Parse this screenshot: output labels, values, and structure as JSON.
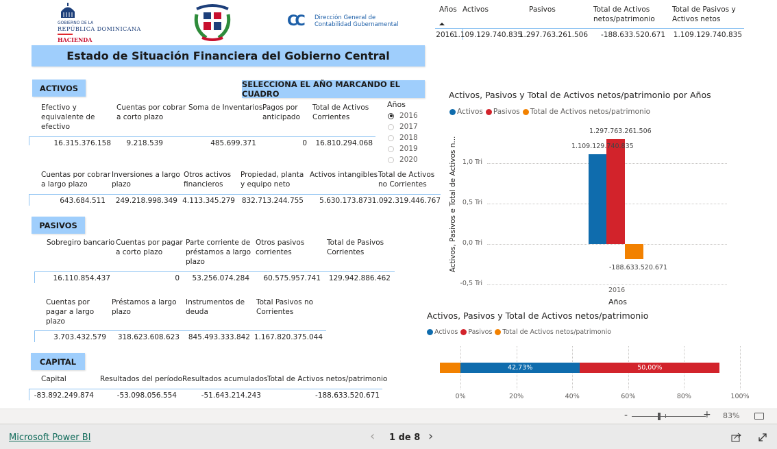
{
  "header": {
    "logo_gobierno": {
      "line1": "GOBIERNO DE LA",
      "line2": "REPÚBLICA DOMINICANA",
      "line3": "HACIENDA"
    },
    "logo_dgcg": {
      "mark": "CC",
      "line1": "Dirección General de",
      "line2": "Contabilidad Gubernamental"
    },
    "title": "Estado de Situación Financiera del Gobierno Central"
  },
  "sections": {
    "activos": "ACTIVOS",
    "pasivos": "PASIVOS",
    "capital": "CAPITAL",
    "select_year": "SELECCIONA EL AÑO MARCANDO EL CUADRO"
  },
  "year_slicer": {
    "title": "Años",
    "options": [
      {
        "label": "2016",
        "selected": true
      },
      {
        "label": "2017",
        "selected": false
      },
      {
        "label": "2018",
        "selected": false
      },
      {
        "label": "2019",
        "selected": false
      },
      {
        "label": "2020",
        "selected": false
      }
    ]
  },
  "tables": {
    "activos_corrientes": {
      "headers": [
        "Efectivo y\nequivalente de\nefectivo",
        "Cuentas por cobrar\na corto plazo",
        "Soma de Inventarios",
        "Pagos por\nanticipado",
        "Total de Activos\nCorrientes"
      ],
      "values": [
        "16.315.376.158",
        "9.218.539",
        "485.699.371",
        "0",
        "16.810.294.068"
      ]
    },
    "activos_no_corrientes": {
      "headers": [
        "Cuentas por cobrar\na largo plazo",
        "Inversiones a largo\nplazo",
        "Otros activos\nfinancieros",
        "Propiedad, planta\ny equipo neto",
        "Activos intangibles",
        "Total de Activos\nno Corrientes"
      ],
      "values": [
        "643.684.511",
        "249.218.998.349",
        "4.113.345.279",
        "832.713.244.755",
        "5.630.173.873",
        "1.092.319.446.767"
      ]
    },
    "pasivos_corrientes": {
      "headers": [
        "Sobregiro bancario",
        "Cuentas por pagar\na corto plazo",
        "Parte corriente de\npréstamos a largo\nplazo",
        "Otros pasivos\ncorrientes",
        "Total de Pasivos\nCorrientes"
      ],
      "values": [
        "16.110.854.437",
        "0",
        "53.256.074.284",
        "60.575.957.741",
        "129.942.886.462"
      ]
    },
    "pasivos_no_corrientes": {
      "headers": [
        "Cuentas por\npagar a largo\nplazo",
        "Préstamos a largo\nplazo",
        "Instrumentos de\ndeuda",
        "Total Pasivos no\nCorrientes"
      ],
      "values": [
        "3.703.432.579",
        "318.623.608.623",
        "845.493.333.842",
        "1.167.820.375.044"
      ]
    },
    "capital": {
      "headers": [
        "Capital",
        "Resultados del período",
        "Resultados acumulados",
        "Total de Activos netos/patrimonio"
      ],
      "values": [
        "-83.892.249.874",
        "-53.098.056.554",
        "-51.643.214.243",
        "-188.633.520.671"
      ]
    },
    "resumen": {
      "headers": [
        "Años",
        "Activos",
        "Pasivos",
        "Total de Activos\nnetos/patrimonio",
        "Total de Pasivos y\nActivos netos"
      ],
      "values": [
        "2016",
        "1.109.129.740.835",
        "1.297.763.261.506",
        "-188.633.520.671",
        "1.109.129.740.835"
      ]
    }
  },
  "chart_data": [
    {
      "type": "bar",
      "title": "Activos, Pasivos y Total de Activos netos/patrimonio por Años",
      "xlabel": "Años",
      "ylabel": "Activos, Pasivos e Total de Activos n...",
      "categories": [
        "2016"
      ],
      "series": [
        {
          "name": "Activos",
          "values": [
            1109129740835
          ],
          "label": "1.109.129.740.835",
          "color": "#0f6cad"
        },
        {
          "name": "Pasivos",
          "values": [
            1297763261506
          ],
          "label": "1.297.763.261.506",
          "color": "#d2232b"
        },
        {
          "name": "Total de Activos netos/patrimonio",
          "values": [
            -188633520671
          ],
          "label": "-188.633.520.671",
          "color": "#f28100"
        }
      ],
      "yticks": [
        {
          "value": 1.0,
          "label": "1,0 Tri"
        },
        {
          "value": 0.5,
          "label": "0,5 Tri"
        },
        {
          "value": 0.0,
          "label": "0,0 Tri"
        },
        {
          "value": -0.5,
          "label": "-0,5 Tri"
        }
      ],
      "ylim": [
        -0.5,
        1.3
      ],
      "yunit": "Tri",
      "grid": true,
      "legend": "top-left"
    },
    {
      "type": "bar",
      "orientation": "horizontal-100%-stacked",
      "title": "Activos, Pasivos y Total de Activos netos/patrimonio",
      "series": [
        {
          "name": "Activos",
          "value": 42.73,
          "label": "42,73%",
          "color": "#0f6cad"
        },
        {
          "name": "Pasivos",
          "value": 50.0,
          "label": "50,00%",
          "color": "#d2232b"
        },
        {
          "name": "Total de Activos netos/patrimonio",
          "value": -7.27,
          "label": "",
          "color": "#f28100"
        }
      ],
      "xticks": [
        "0%",
        "20%",
        "40%",
        "60%",
        "80%",
        "100%"
      ],
      "xlim": [
        0,
        100
      ],
      "grid": true,
      "legend": "top-left"
    }
  ],
  "zoom": {
    "minus": "-",
    "plus": "+",
    "level_label": "83%",
    "level": 83
  },
  "footer": {
    "brand": "Microsoft Power BI",
    "page_indicator": "1 de 8",
    "prev": "‹",
    "next": "›"
  }
}
